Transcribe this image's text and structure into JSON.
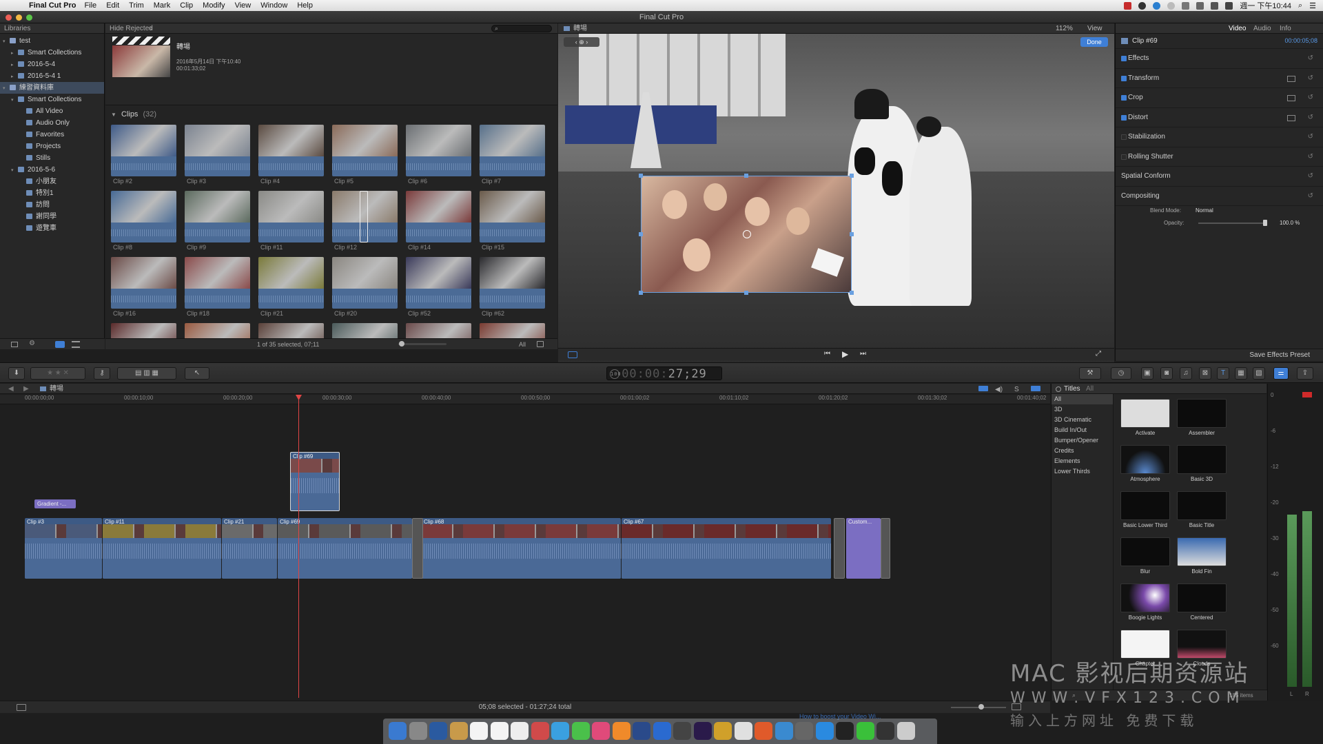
{
  "menubar": {
    "app_name": "Final Cut Pro",
    "items": [
      "File",
      "Edit",
      "Trim",
      "Mark",
      "Clip",
      "Modify",
      "View",
      "Window",
      "Help"
    ],
    "clock": "週一 下午10:44"
  },
  "window": {
    "title": "Final Cut Pro"
  },
  "libraries": {
    "header": "Libraries",
    "rows": [
      {
        "label": "test",
        "level": 0,
        "type": "library"
      },
      {
        "label": "Smart Collections",
        "level": 1,
        "type": "folder"
      },
      {
        "label": "2016-5-4",
        "level": 1,
        "type": "event"
      },
      {
        "label": "2016-5-4 1",
        "level": 1,
        "type": "event"
      },
      {
        "label": "練習資料庫",
        "level": 0,
        "type": "library",
        "selected": true
      },
      {
        "label": "Smart Collections",
        "level": 1,
        "type": "folder"
      },
      {
        "label": "All Video",
        "level": 2,
        "type": "collection"
      },
      {
        "label": "Audio Only",
        "level": 2,
        "type": "collection"
      },
      {
        "label": "Favorites",
        "level": 2,
        "type": "collection"
      },
      {
        "label": "Projects",
        "level": 2,
        "type": "collection"
      },
      {
        "label": "Stills",
        "level": 2,
        "type": "collection"
      },
      {
        "label": "2016-5-6",
        "level": 1,
        "type": "event"
      },
      {
        "label": "小朋友",
        "level": 2,
        "type": "keyword"
      },
      {
        "label": "特別1",
        "level": 2,
        "type": "keyword"
      },
      {
        "label": "訪問",
        "level": 2,
        "type": "keyword"
      },
      {
        "label": "謝同學",
        "level": 2,
        "type": "keyword"
      },
      {
        "label": "遊覽車",
        "level": 2,
        "type": "keyword"
      }
    ]
  },
  "browser": {
    "filter": "Hide Rejected",
    "project": {
      "name": "轉場",
      "date": "2016年5月14日 下午10:40",
      "duration": "00:01:33;02"
    },
    "clips_label": "Clips",
    "clips_count": "(32)",
    "clips": [
      {
        "label": "Clip #2",
        "color": "#3e5a88"
      },
      {
        "label": "Clip #3",
        "color": "#7b8390"
      },
      {
        "label": "Clip #4",
        "color": "#5a4a40"
      },
      {
        "label": "Clip #5",
        "color": "#8a6a58"
      },
      {
        "label": "Clip #6",
        "color": "#6a6e72"
      },
      {
        "label": "Clip #7",
        "color": "#566f8a"
      },
      {
        "label": "Clip #8",
        "color": "#476a96"
      },
      {
        "label": "Clip #9",
        "color": "#5b6a5e"
      },
      {
        "label": "Clip #11",
        "color": "#8a8a86"
      },
      {
        "label": "Clip #12",
        "color": "#8a7a6a"
      },
      {
        "label": "Clip #14",
        "color": "#7a3a3a"
      },
      {
        "label": "Clip #15",
        "color": "#6a5a4a"
      },
      {
        "label": "Clip #16",
        "color": "#6a4a46"
      },
      {
        "label": "Clip #18",
        "color": "#8a4a4a"
      },
      {
        "label": "Clip #21",
        "color": "#7a7a3a"
      },
      {
        "label": "Clip #20",
        "color": "#8a8680"
      },
      {
        "label": "Clip #52",
        "color": "#3a3a5a"
      },
      {
        "label": "Clip #62",
        "color": "#2a2a2e"
      },
      {
        "label": "",
        "color": "#5a2a2a"
      },
      {
        "label": "",
        "color": "#9a5a40"
      },
      {
        "label": "",
        "color": "#5a4038"
      },
      {
        "label": "",
        "color": "#4a5a5a"
      },
      {
        "label": "",
        "color": "#6a4a4a"
      },
      {
        "label": "",
        "color": "#7a3a30"
      }
    ],
    "status": "1 of 35 selected, 07;11",
    "all_label": "All"
  },
  "viewer": {
    "title": "轉場",
    "zoom": "112%",
    "view_label": "View",
    "done_label": "Done"
  },
  "inspector": {
    "tabs": [
      "Video",
      "Audio",
      "Info"
    ],
    "clip_name": "Clip #69",
    "clip_time": "00:00:05;08",
    "sections": [
      "Effects",
      "Transform",
      "Crop",
      "Distort",
      "Stabilization",
      "Rolling Shutter",
      "Spatial Conform",
      "Compositing"
    ],
    "blend_mode_label": "Blend Mode:",
    "blend_mode_value": "Normal",
    "opacity_label": "Opacity:",
    "opacity_value": "100.0 %",
    "opacity_level": 1.0,
    "save_preset": "Save Effects Preset"
  },
  "toolbar": {
    "timecode": "27;29"
  },
  "timeline": {
    "project_name": "轉場",
    "ruler": [
      "00:00:00;00",
      "00:00:10;00",
      "00:00:20;00",
      "00:00:30;00",
      "00:00:40;00",
      "00:00:50;00",
      "00:01:00;02",
      "00:01:10;02",
      "00:01:20;02",
      "00:01:30;02",
      "00:01:40;02"
    ],
    "connected_clip": "Clip #69",
    "title_clip": "Gradient -...",
    "primary_clips": [
      "Clip #3",
      "Clip #11",
      "Clip #21",
      "Clip #69",
      "Clip #68",
      "Clip #67",
      "Custom..."
    ],
    "status": "05;08 selected - 01:27;24 total"
  },
  "titles": {
    "header": "Titles",
    "filter": "All",
    "categories": [
      "All",
      "3D",
      "3D Cinematic",
      "Build In/Out",
      "Bumper/Opener",
      "Credits",
      "Elements",
      "Lower Thirds"
    ],
    "items": [
      "Activate",
      "Assembler",
      "Atmosphere",
      "Basic 3D",
      "Basic Lower Third",
      "Basic Title",
      "Blur",
      "Bold Fin",
      "Boogie Lights",
      "Centered",
      "Chapter",
      "Clouds"
    ],
    "count": "185 items"
  },
  "meters": {
    "scale": [
      "0",
      "-6",
      "-12",
      "-20",
      "-30",
      "-40",
      "-50",
      "-60"
    ],
    "channels": [
      "L",
      "R"
    ]
  },
  "watermark": {
    "line1": "MAC 影视后期资源站",
    "line2": "W W W . V F X 1 2 3 . C O M",
    "line3": "输入上方网址 免费下载"
  },
  "tooltip_text": "How to boost your Video Wi... "
}
